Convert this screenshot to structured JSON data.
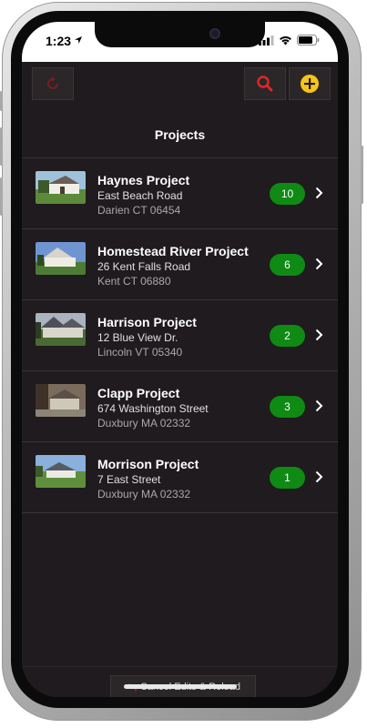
{
  "status": {
    "time": "1:23"
  },
  "toolbar": {
    "title": "Projects"
  },
  "projects": [
    {
      "name": "Haynes Project",
      "address": "East Beach Road",
      "city": "Darien CT 06454",
      "count": "10"
    },
    {
      "name": "Homestead River Project",
      "address": "26 Kent Falls Road",
      "city": "Kent CT 06880",
      "count": "6"
    },
    {
      "name": "Harrison Project",
      "address": "12 Blue View Dr.",
      "city": "Lincoln VT 05340",
      "count": "2"
    },
    {
      "name": "Clapp Project",
      "address": "674 Washington Street",
      "city": "Duxbury MA 02332",
      "count": "3"
    },
    {
      "name": "Morrison Project",
      "address": "7 East Street",
      "city": "Duxbury MA 02332",
      "count": "1"
    }
  ],
  "bottom": {
    "cancel_label": "Cancel Edits & Reload"
  },
  "colors": {
    "badge": "#0f8a14",
    "search": "#e0262b",
    "add": "#f5c518",
    "refresh": "#c4262b"
  }
}
